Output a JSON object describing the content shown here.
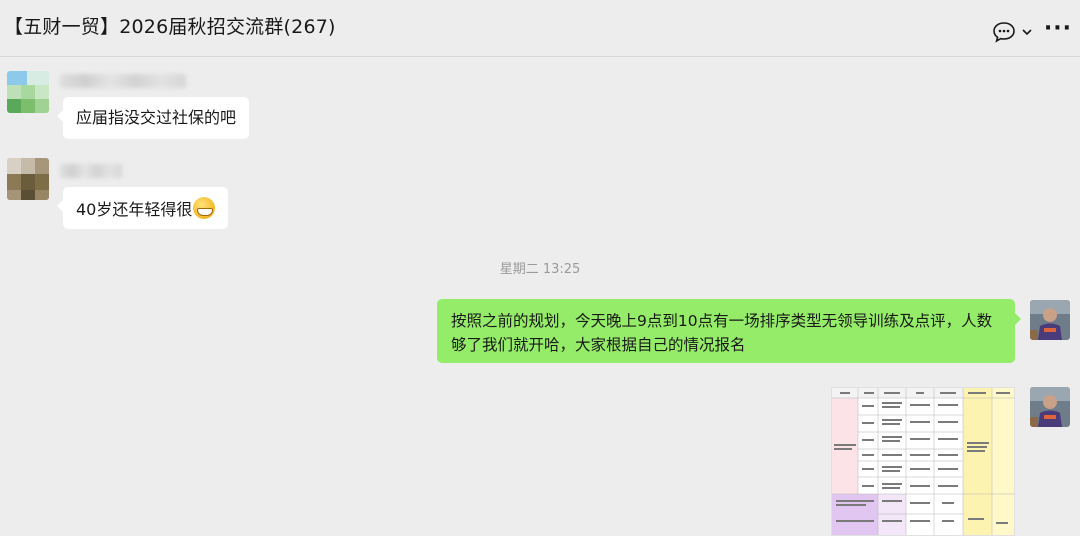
{
  "header": {
    "title": "【五财一贸】2026届秋招交流群(267)",
    "chat_icon": "chat-bubble-icon",
    "dropdown_icon": "chevron-down-icon",
    "more_icon": "more-icon",
    "more_label": "···"
  },
  "messages": [
    {
      "side": "left",
      "text": "应届指没交过社保的吧"
    },
    {
      "side": "left",
      "text": "40岁还年轻得很",
      "emoji": "grinning-face-emoji"
    }
  ],
  "timestamp": "星期二 13:25",
  "outgoing": [
    {
      "side": "right",
      "text": "按照之前的规划，今天晚上9点到10点有一场排序类型无领导训练及点评，人数够了我们就开哈，大家根据自己的情况报名"
    },
    {
      "side": "right",
      "type": "image",
      "content": "table-screenshot-thumbnail"
    }
  ],
  "colors": {
    "background": "#ededed",
    "bubble_out": "#95ec69",
    "bubble_in": "#ffffff"
  }
}
